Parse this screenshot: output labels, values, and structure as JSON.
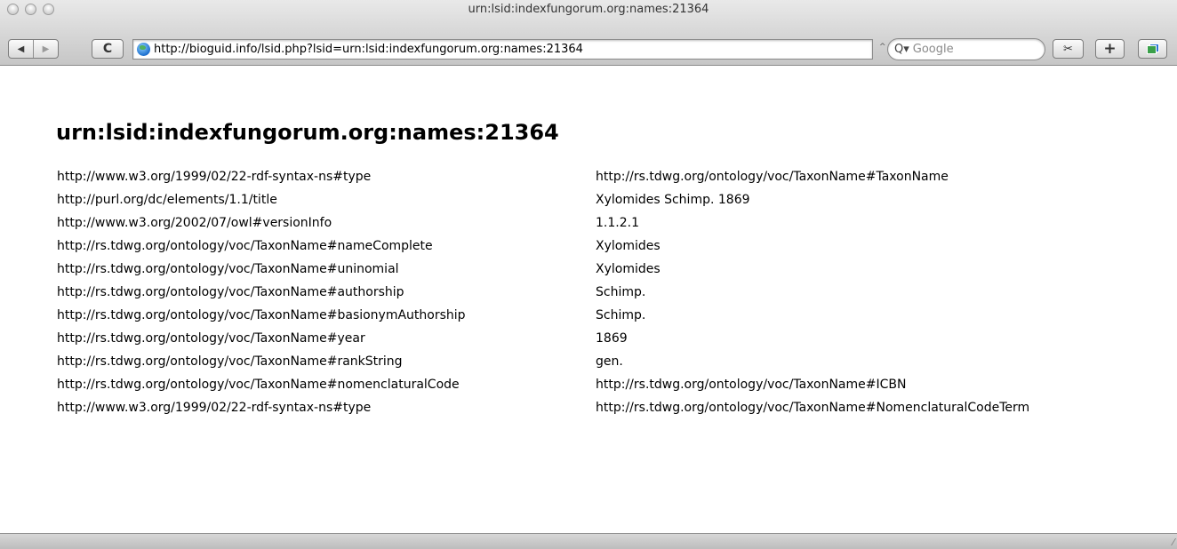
{
  "window": {
    "title": "urn:lsid:indexfungorum.org:names:21364"
  },
  "toolbar": {
    "back_icon": "back-arrow-icon",
    "back_glyph": "◀",
    "forward_icon": "forward-arrow-icon",
    "forward_glyph": "▶",
    "reload_icon": "reload-icon",
    "reload_glyph": "C",
    "url": "http://bioguid.info/lsid.php?lsid=urn:lsid:indexfungorum.org:names:21364",
    "url_dropdown_glyph": "^",
    "search_glyph": "Q▾",
    "search_placeholder": "Google",
    "snapback_icon": "snapback-icon",
    "snapback_glyph": "✂",
    "add_bookmark_glyph": "+",
    "tabs_icon": "tabs-icon"
  },
  "page": {
    "heading": "urn:lsid:indexfungorum.org:names:21364",
    "triples": [
      {
        "predicate": "http://www.w3.org/1999/02/22-rdf-syntax-ns#type",
        "object": "http://rs.tdwg.org/ontology/voc/TaxonName#TaxonName"
      },
      {
        "predicate": "http://purl.org/dc/elements/1.1/title",
        "object": "Xylomides Schimp. 1869"
      },
      {
        "predicate": "http://www.w3.org/2002/07/owl#versionInfo",
        "object": "1.1.2.1"
      },
      {
        "predicate": "http://rs.tdwg.org/ontology/voc/TaxonName#nameComplete",
        "object": "Xylomides"
      },
      {
        "predicate": "http://rs.tdwg.org/ontology/voc/TaxonName#uninomial",
        "object": "Xylomides"
      },
      {
        "predicate": "http://rs.tdwg.org/ontology/voc/TaxonName#authorship",
        "object": "Schimp."
      },
      {
        "predicate": "http://rs.tdwg.org/ontology/voc/TaxonName#basionymAuthorship",
        "object": "Schimp."
      },
      {
        "predicate": "http://rs.tdwg.org/ontology/voc/TaxonName#year",
        "object": "1869"
      },
      {
        "predicate": "http://rs.tdwg.org/ontology/voc/TaxonName#rankString",
        "object": "gen."
      },
      {
        "predicate": "http://rs.tdwg.org/ontology/voc/TaxonName#nomenclaturalCode",
        "object": "http://rs.tdwg.org/ontology/voc/TaxonName#ICBN"
      },
      {
        "predicate": "http://www.w3.org/1999/02/22-rdf-syntax-ns#type",
        "object": "http://rs.tdwg.org/ontology/voc/TaxonName#NomenclaturalCodeTerm"
      }
    ]
  },
  "statusbar": {
    "grip_glyph": "⁄"
  }
}
